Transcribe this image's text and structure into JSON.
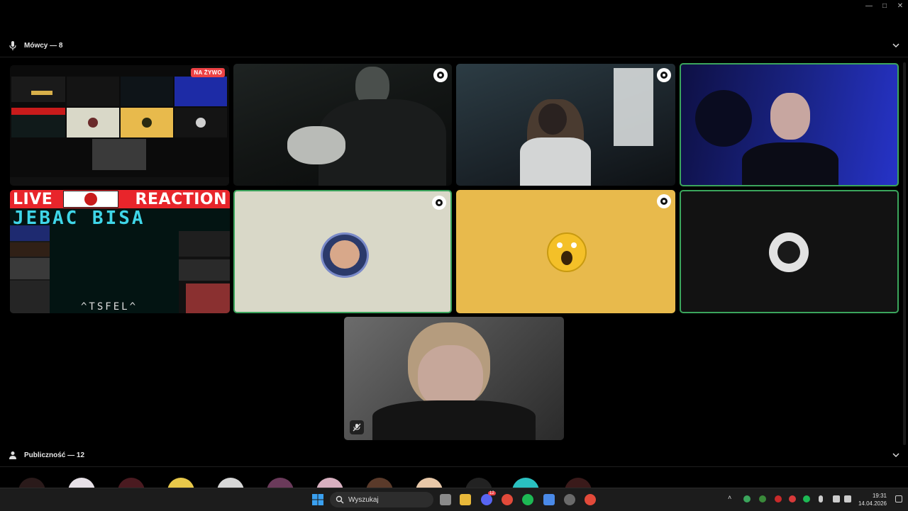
{
  "speakers_section": {
    "title": "Mówcy — 8"
  },
  "audience_section": {
    "title": "Publiczność — 12"
  },
  "stream_tile": {
    "badge": "NA ŻYWO"
  },
  "reaction_tile": {
    "live": "LIVE",
    "reaction": "REACTION",
    "headline": "JEBAC BISA",
    "signature": "^TSFEL^"
  },
  "taskbar": {
    "search_placeholder": "Wyszukaj",
    "time": "19:31",
    "date": "14.04.2026",
    "discord_badge": "12"
  },
  "colors": {
    "speaking_border": "#3ba55c",
    "live_badge": "#ed4245",
    "yellow_tile": "#e8ba4c",
    "beige_tile": "#d9d8c8"
  },
  "icons": [
    "microphone-icon",
    "audience-icon",
    "chevron-down-icon",
    "shield-icon",
    "mic-muted-icon",
    "search-icon",
    "windows-start-icon"
  ]
}
